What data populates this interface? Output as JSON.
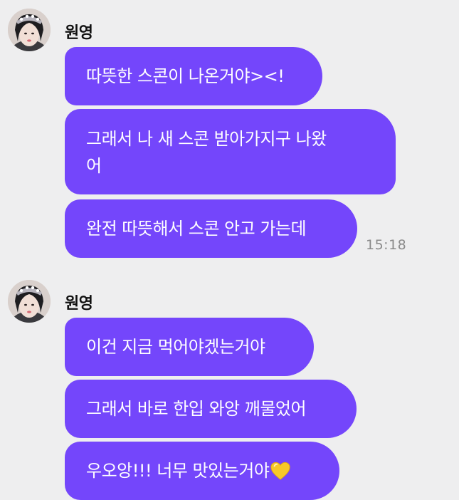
{
  "colors": {
    "background": "#eeeeef",
    "bubble": "#7446fb",
    "bubble_text": "#ffffff",
    "timestamp": "#8a8a8a",
    "heart": "#f7c829"
  },
  "groups": [
    {
      "sender": "원영",
      "avatar_icon": "profile-photo",
      "messages": [
        {
          "text": "따뜻한 스콘이 나온거야><!"
        },
        {
          "text": "그래서 나 새 스콘 받아가지구 나왔\n어"
        },
        {
          "text": "완전 따뜻해서 스콘 안고 가는데"
        }
      ],
      "timestamp": "15:18"
    },
    {
      "sender": "원영",
      "avatar_icon": "profile-photo",
      "messages": [
        {
          "text": "이건 지금 먹어야겠는거야"
        },
        {
          "text": "그래서 바로 한입 와앙 깨물었어"
        },
        {
          "text": "우오앙!!! 너무 맛있는거야",
          "emoji": "yellow-heart-icon"
        }
      ]
    }
  ]
}
